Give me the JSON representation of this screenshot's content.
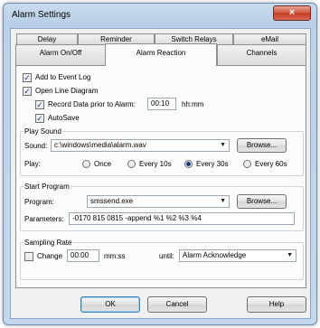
{
  "window": {
    "title": "Alarm Settings",
    "close_glyph": "×"
  },
  "tabs": {
    "row1": [
      "Delay",
      "Reminder",
      "Switch Relays",
      "eMail"
    ],
    "row2": [
      "Alarm On/Off",
      "Alarm Reaction",
      "Channels"
    ],
    "active": "Alarm Reaction"
  },
  "options": {
    "add_to_event_log": {
      "label": "Add to Event Log",
      "checked": true
    },
    "open_line_diagram": {
      "label": "Open Line Diagram",
      "checked": true
    },
    "record_data": {
      "label": "Record Data prior to Alarm:",
      "checked": true,
      "value": "00:10",
      "unit": "hh:mm"
    },
    "autosave": {
      "label": "AutoSave",
      "checked": true
    }
  },
  "play_sound": {
    "group_title": "Play Sound",
    "sound_label": "Sound:",
    "sound_value": "c:\\windows\\media\\alarm.wav",
    "browse_label": "Browse...",
    "play_label": "Play:",
    "play_options": [
      "Once",
      "Every 10s",
      "Every 30s",
      "Every 60s"
    ],
    "play_selected": "Every 30s"
  },
  "start_program": {
    "group_title": "Start Program",
    "program_label": "Program:",
    "program_value": "smssend.exe",
    "browse_label": "Browse...",
    "parameters_label": "Parameters:",
    "parameters_value": "-0170 815 0815 -append %1 %2 %3 %4"
  },
  "sampling_rate": {
    "group_title": "Sampling Rate",
    "change_label": "Change",
    "change_checked": false,
    "change_value": "00:00",
    "unit": "mm:ss",
    "until_label": "until:",
    "until_value": "Alarm Acknowledge"
  },
  "footer": {
    "ok_label": "OK",
    "cancel_label": "Cancel",
    "help_label": "Help"
  },
  "icons": {
    "check": "✓",
    "dropdown": "▼"
  }
}
